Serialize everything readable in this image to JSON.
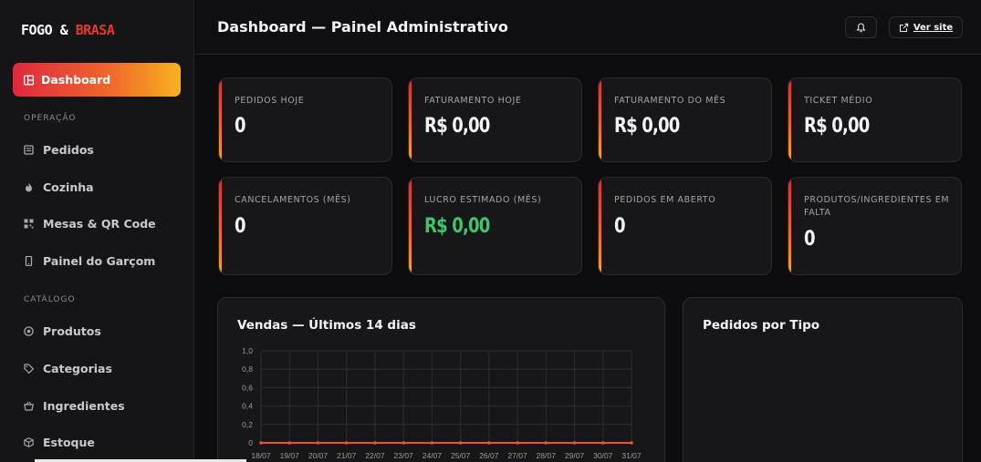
{
  "brand": {
    "part1": "FOGO & ",
    "part2": "BRASA",
    "accent_color": "#e23a2f"
  },
  "sidebar": {
    "active": {
      "label": "Dashboard",
      "icon": "dashboard-icon"
    },
    "sections": [
      {
        "title": "OPERAÇÃO",
        "items": [
          {
            "label": "Pedidos",
            "icon": "receipt-icon"
          },
          {
            "label": "Cozinha",
            "icon": "flame-icon"
          },
          {
            "label": "Mesas & QR Code",
            "icon": "qr-code-icon"
          },
          {
            "label": "Painel do Garçom",
            "icon": "phone-icon"
          }
        ]
      },
      {
        "title": "CATÁLOGO",
        "items": [
          {
            "label": "Produtos",
            "icon": "target-icon"
          },
          {
            "label": "Categorias",
            "icon": "tag-icon"
          },
          {
            "label": "Ingredientes",
            "icon": "basket-icon"
          },
          {
            "label": "Estoque",
            "icon": "box-icon"
          }
        ]
      }
    ]
  },
  "header": {
    "title": "Dashboard — Painel Administrativo",
    "bell_icon": "bell-icon",
    "site_button": {
      "label": "Ver site",
      "icon": "external-link-icon"
    }
  },
  "kpis": [
    {
      "label": "PEDIDOS HOJE",
      "value": "0"
    },
    {
      "label": "FATURAMENTO HOJE",
      "value": "R$ 0,00"
    },
    {
      "label": "FATURAMENTO DO MÊS",
      "value": "R$ 0,00"
    },
    {
      "label": "TICKET MÉDIO",
      "value": "R$ 0,00"
    },
    {
      "label": "CANCELAMENTOS (MÊS)",
      "value": "0"
    },
    {
      "label": "LUCRO ESTIMADO (MÊS)",
      "value": "R$ 0,00",
      "color": "#3fc56b"
    },
    {
      "label": "PEDIDOS EM ABERTO",
      "value": "0"
    },
    {
      "label": "PRODUTOS/INGREDIENTES EM FALTA",
      "value": "0"
    }
  ],
  "sales_panel": {
    "title": "Vendas — Últimos 14 dias"
  },
  "orders_panel": {
    "title": "Pedidos por Tipo"
  },
  "chart_data": {
    "type": "line",
    "title": "Vendas — Últimos 14 dias",
    "categories": [
      "18/07",
      "19/07",
      "20/07",
      "21/07",
      "22/07",
      "23/07",
      "24/07",
      "25/07",
      "26/07",
      "27/07",
      "28/07",
      "29/07",
      "30/07",
      "31/07"
    ],
    "y_tick_labels": [
      "0",
      "0,2",
      "0,4",
      "0,6",
      "0,8",
      "1,0"
    ],
    "ylim": [
      0,
      1
    ],
    "series": [
      {
        "values": [
          0,
          0,
          0,
          0,
          0,
          0,
          0,
          0,
          0,
          0,
          0,
          0,
          0,
          0
        ],
        "color": "#e8552f"
      }
    ],
    "grid": true
  }
}
